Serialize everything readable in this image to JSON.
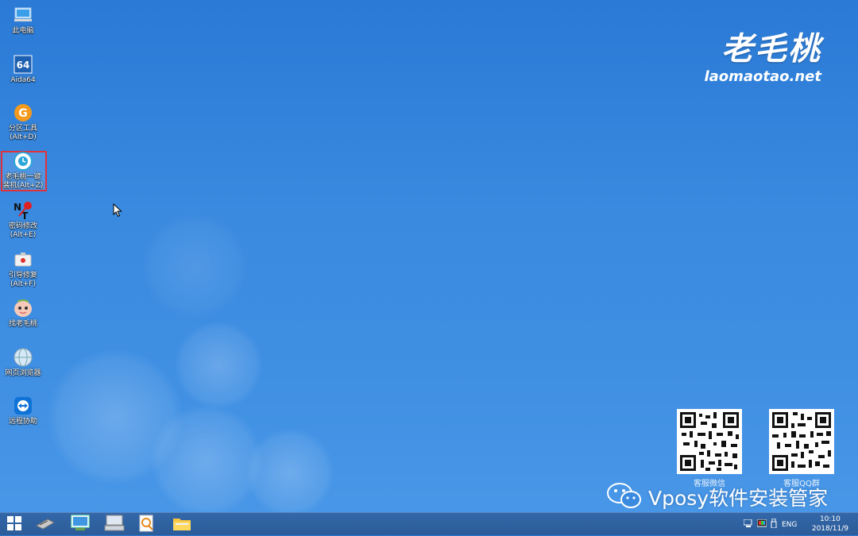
{
  "desktop_icons": [
    {
      "name": "this-pc",
      "label": "此电脑",
      "icon": "computer-icon"
    },
    {
      "name": "aida64",
      "label": "Aida64",
      "icon": "aida64-icon"
    },
    {
      "name": "partition-tool",
      "label": "分区工具\n(Alt+D)",
      "icon": "partition-icon"
    },
    {
      "name": "one-click-install",
      "label": "老毛桃一键\n装机(Alt+Z)",
      "icon": "install-icon"
    },
    {
      "name": "password-change",
      "label": "密码修改\n(Alt+E)",
      "icon": "ntpwd-icon"
    },
    {
      "name": "boot-repair",
      "label": "引导修复\n(Alt+F)",
      "icon": "boot-repair-icon"
    },
    {
      "name": "find-laomaotao",
      "label": "找老毛桃",
      "icon": "peach-icon"
    },
    {
      "name": "web-browser",
      "label": "网页浏览器",
      "icon": "globe-icon"
    },
    {
      "name": "remote-assist",
      "label": "远程协助",
      "icon": "teamviewer-icon"
    }
  ],
  "brand": {
    "cn": "老毛桃",
    "en": "laomaotao.net"
  },
  "qr_codes": [
    {
      "label": "客服微信"
    },
    {
      "label": "客服QQ群"
    }
  ],
  "watermark": {
    "text": "Vposy软件安装管家",
    "icon": "wechat-icon"
  },
  "taskbar": {
    "buttons": [
      "start-icon",
      "hardware-icon",
      "computer-monitor-icon",
      "keyboard-icon",
      "search-tool-icon",
      "folder-icon"
    ],
    "tray": {
      "language": "ENG",
      "time": "10:10",
      "date": "2018/11/9"
    }
  },
  "colors": {
    "desktop": "#3a8ae0",
    "taskbar": "#2f60a0",
    "selection": "#e0323a"
  }
}
